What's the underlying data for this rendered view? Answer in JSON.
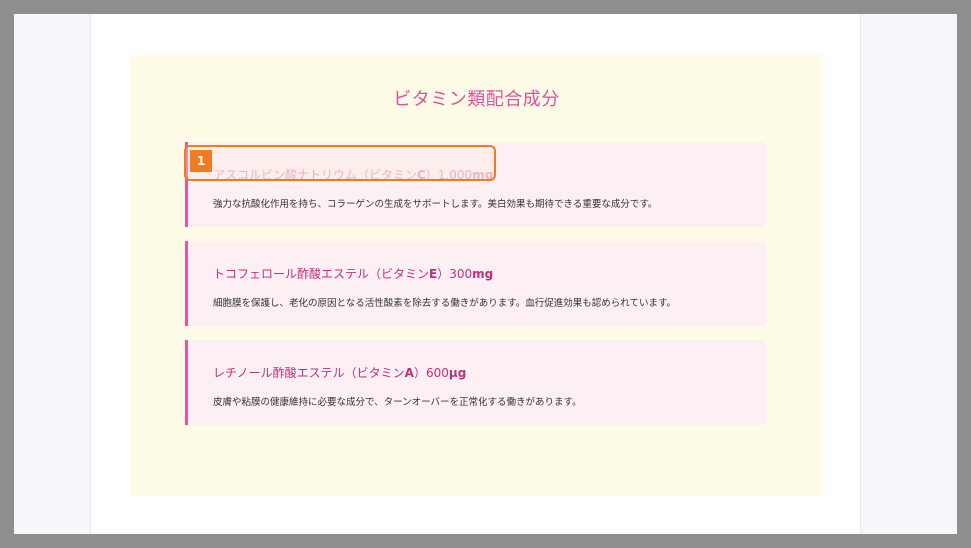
{
  "section": {
    "title": "ビタミン類配合成分"
  },
  "items": [
    {
      "name_prefix": "アスコルビン酸ナトリウム（ビタミン",
      "name_letter": "C",
      "name_suffix": "）1,000",
      "name_unit": "mg",
      "description": "強力な抗酸化作用を持ち、コラーゲンの生成をサポートします。美白効果も期待できる重要な成分です。"
    },
    {
      "name_prefix": "トコフェロール酢酸エステル（ビタミン",
      "name_letter": "E",
      "name_suffix": "）300",
      "name_unit": "mg",
      "description": "細胞膜を保護し、老化の原因となる活性酸素を除去する働きがあります。血行促進効果も認められています。"
    },
    {
      "name_prefix": "レチノール酢酸エステル（ビタミン",
      "name_letter": "A",
      "name_suffix": "）600",
      "name_unit": "μg",
      "description": "皮膚や粘膜の健康維持に必要な成分で、ターンオーバーを正常化する働きがあります。"
    }
  ],
  "annotation": {
    "marker_label": "1",
    "color": "#ef7b23"
  },
  "colors": {
    "accent": "#e9559f",
    "title": "#e0509c",
    "item_title": "#c2307c",
    "section_bg": "#fefbe6",
    "card_bg": "#fcf0f5"
  }
}
